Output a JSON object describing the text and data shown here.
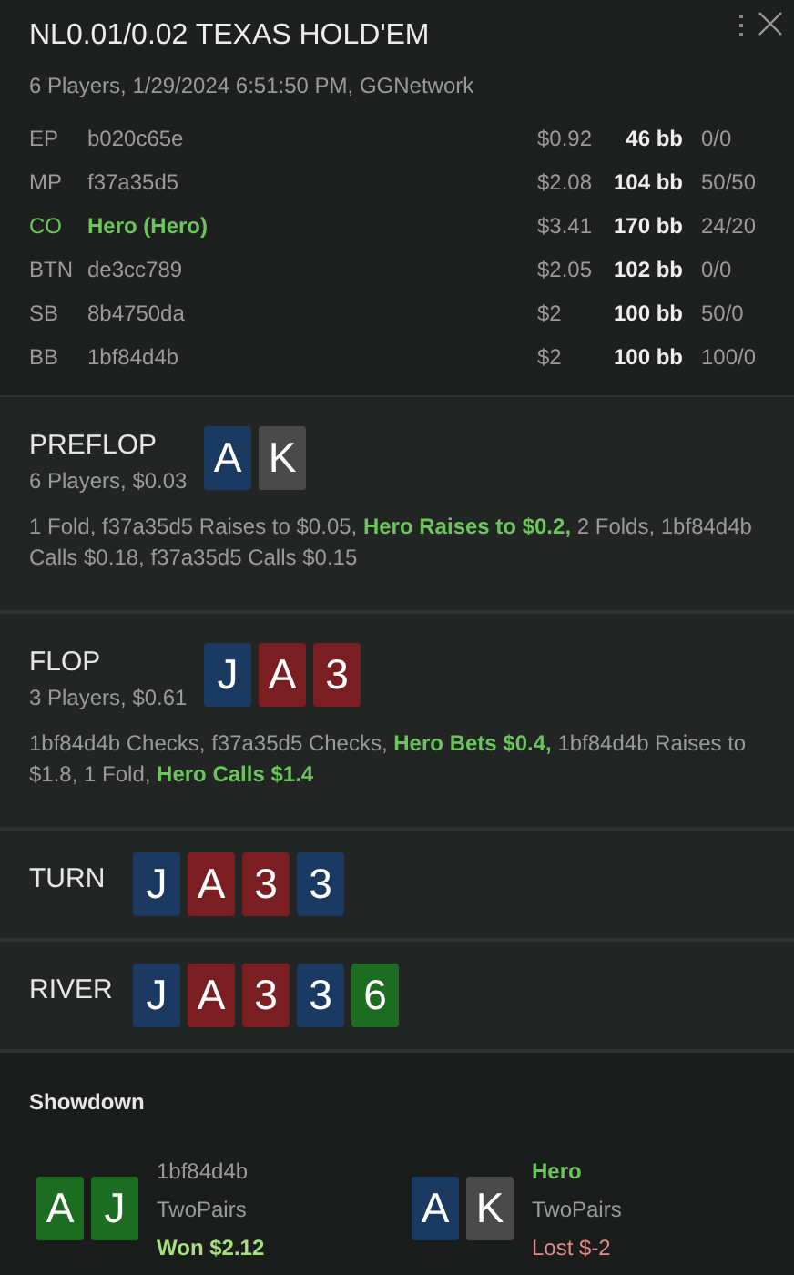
{
  "header": {
    "title": "NL0.01/0.02 TEXAS HOLD'EM",
    "subtitle": "6 Players, 1/29/2024 6:51:50 PM, GGNetwork"
  },
  "players": [
    {
      "position": "EP",
      "name": "b020c65e",
      "stack": "$0.92",
      "bb": "46 bb",
      "stats": "0/0",
      "hero": false
    },
    {
      "position": "MP",
      "name": "f37a35d5",
      "stack": "$2.08",
      "bb": "104 bb",
      "stats": "50/50",
      "hero": false
    },
    {
      "position": "CO",
      "name": "Hero (Hero)",
      "stack": "$3.41",
      "bb": "170 bb",
      "stats": "24/20",
      "hero": true
    },
    {
      "position": "BTN",
      "name": "de3cc789",
      "stack": "$2.05",
      "bb": "102 bb",
      "stats": "0/0",
      "hero": false
    },
    {
      "position": "SB",
      "name": "8b4750da",
      "stack": "$2",
      "bb": "100 bb",
      "stats": "50/0",
      "hero": false
    },
    {
      "position": "BB",
      "name": "1bf84d4b",
      "stack": "$2",
      "bb": "100 bb",
      "stats": "100/0",
      "hero": false
    }
  ],
  "streets": [
    {
      "name": "PREFLOP",
      "info": "6 Players, $0.03",
      "cards": [
        {
          "rank": "A",
          "color": "#1b3a62"
        },
        {
          "rank": "K",
          "color": "#4a4a4a"
        }
      ],
      "actions": "1 Fold, f37a35d5 Raises to $0.05, **Hero Raises to $0.2,** 2 Folds, 1bf84d4b Calls $0.18, f37a35d5 Calls $0.15"
    },
    {
      "name": "FLOP",
      "info": "3 Players, $0.61",
      "cards": [
        {
          "rank": "J",
          "color": "#1b3a62"
        },
        {
          "rank": "A",
          "color": "#7b1e22"
        },
        {
          "rank": "3",
          "color": "#7b1e22"
        }
      ],
      "actions": "1bf84d4b Checks, f37a35d5 Checks, **Hero Bets $0.4,** 1bf84d4b Raises to $1.8, 1 Fold, **Hero Calls $1.4**"
    },
    {
      "name": "TURN",
      "cards": [
        {
          "rank": "J",
          "color": "#1b3a62"
        },
        {
          "rank": "A",
          "color": "#7b1e22"
        },
        {
          "rank": "3",
          "color": "#7b1e22"
        },
        {
          "rank": "3",
          "color": "#1b3a62"
        }
      ]
    },
    {
      "name": "RIVER",
      "cards": [
        {
          "rank": "J",
          "color": "#1b3a62"
        },
        {
          "rank": "A",
          "color": "#7b1e22"
        },
        {
          "rank": "3",
          "color": "#7b1e22"
        },
        {
          "rank": "3",
          "color": "#1b3a62"
        },
        {
          "rank": "6",
          "color": "#1e6b22"
        }
      ]
    }
  ],
  "showdown": {
    "title": "Showdown",
    "hands": [
      {
        "player": "1bf84d4b",
        "hero": false,
        "hand": "TwoPairs",
        "result": "Won $2.12",
        "won": true,
        "cards": [
          {
            "rank": "A",
            "color": "#1e6b22"
          },
          {
            "rank": "J",
            "color": "#1e6b22"
          }
        ]
      },
      {
        "player": "Hero",
        "hero": true,
        "hand": "TwoPairs",
        "result": "Lost $-2",
        "won": false,
        "cards": [
          {
            "rank": "A",
            "color": "#1b3a62"
          },
          {
            "rank": "K",
            "color": "#4a4a4a"
          }
        ]
      }
    ]
  }
}
